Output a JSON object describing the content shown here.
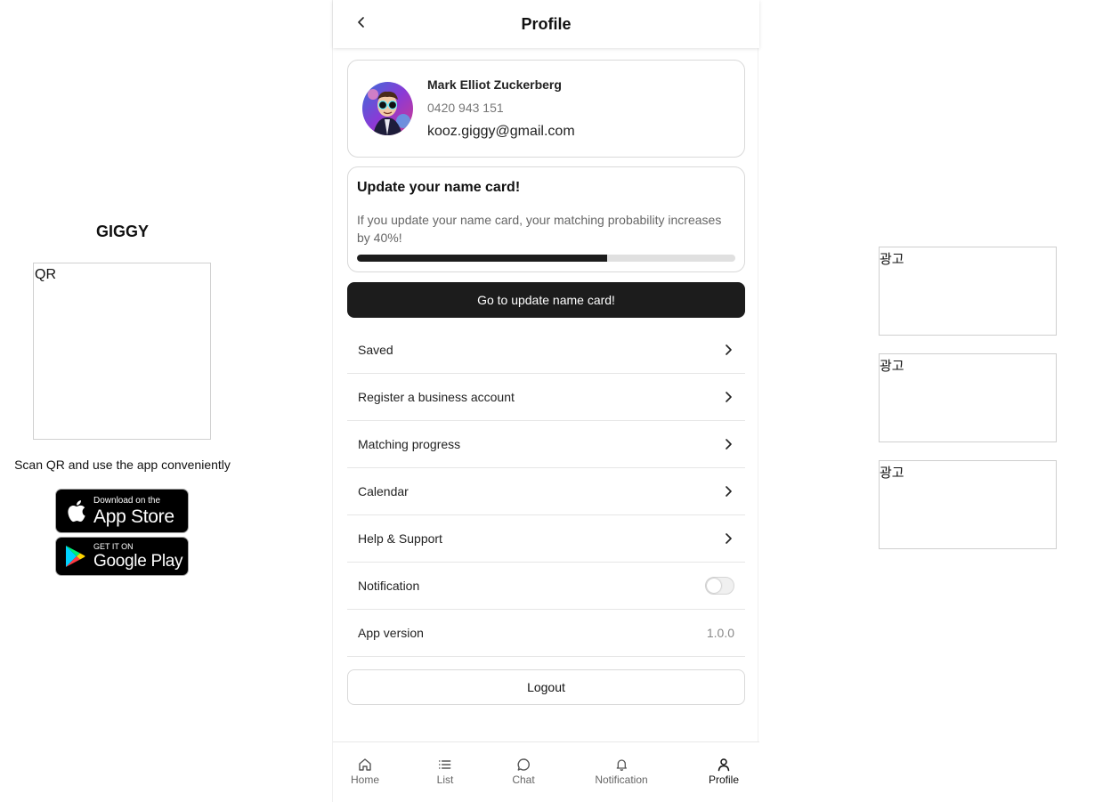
{
  "left_panel": {
    "brand": "GIGGY",
    "qr_label": "QR",
    "scan_text": "Scan QR and use the app conveniently",
    "app_store": {
      "small": "Download on the",
      "big": "App Store"
    },
    "google_play": {
      "small": "GET IT ON",
      "big": "Google Play"
    }
  },
  "ads": [
    {
      "label": "광고"
    },
    {
      "label": "광고"
    },
    {
      "label": "광고"
    }
  ],
  "header": {
    "title": "Profile",
    "back_icon": "chevron-left-icon"
  },
  "profile": {
    "name": "Mark Elliot Zuckerberg",
    "phone": "0420 943 151",
    "email": "kooz.giggy@gmail.com"
  },
  "namecard": {
    "title": "Update your name card!",
    "description": "If you update your name card, your matching probability increases by 40%!",
    "progress_fraction": 0.66,
    "button_label": "Go to update name card!"
  },
  "menu": {
    "items": [
      {
        "label": "Saved"
      },
      {
        "label": "Register a business account"
      },
      {
        "label": "Matching progress"
      },
      {
        "label": "Calendar"
      },
      {
        "label": "Help & Support"
      }
    ],
    "notification_label": "Notification",
    "notification_enabled": false,
    "app_version_label": "App version",
    "app_version_value": "1.0.0"
  },
  "logout_label": "Logout",
  "bottom_nav": {
    "items": [
      {
        "label": "Home",
        "icon": "home-icon"
      },
      {
        "label": "List",
        "icon": "list-icon"
      },
      {
        "label": "Chat",
        "icon": "chat-icon"
      },
      {
        "label": "Notification",
        "icon": "bell-icon"
      },
      {
        "label": "Profile",
        "icon": "user-icon"
      }
    ],
    "active": "Profile"
  },
  "colors": {
    "primary_dark": "#1c1c1c",
    "border": "#d9d9d9",
    "muted_text": "#777777"
  }
}
